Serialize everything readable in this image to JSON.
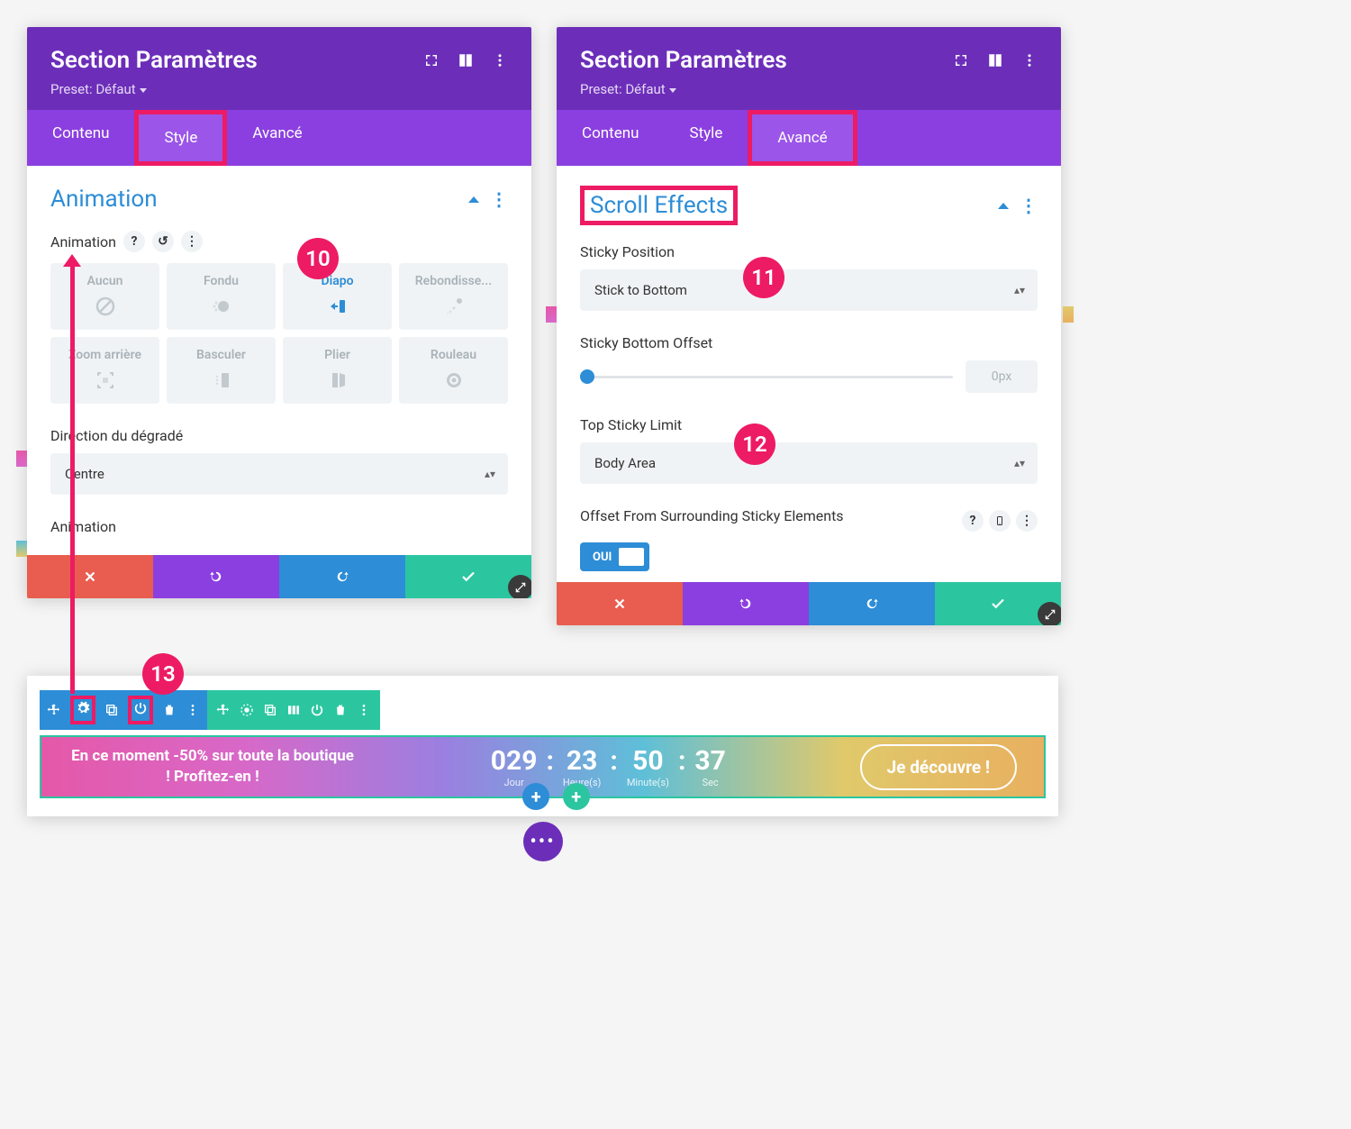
{
  "leftPanel": {
    "title": "Section Paramètres",
    "preset": "Preset: Défaut",
    "tabs": {
      "contenu": "Contenu",
      "style": "Style",
      "avance": "Avancé"
    },
    "sectionTitle": "Animation",
    "animLabel": "Animation",
    "help": "?",
    "options": {
      "aucun": "Aucun",
      "fondu": "Fondu",
      "diapo": "Diapo",
      "rebond": "Rebondisse...",
      "zoom": "Zoom arrière",
      "basculer": "Basculer",
      "plier": "Plier",
      "rouleau": "Rouleau"
    },
    "directionLabel": "Direction du dégradé",
    "directionValue": "Centre",
    "animLower": "Animation"
  },
  "rightPanel": {
    "title": "Section Paramètres",
    "preset": "Preset: Défaut",
    "tabs": {
      "contenu": "Contenu",
      "style": "Style",
      "avance": "Avancé"
    },
    "sectionTitle": "Scroll Effects",
    "stickyPosLabel": "Sticky Position",
    "stickyPosValue": "Stick to Bottom",
    "stickyOffsetLabel": "Sticky Bottom Offset",
    "stickyOffsetValue": "0px",
    "topLimitLabel": "Top Sticky Limit",
    "topLimitValue": "Body Area",
    "offsetElLabel": "Offset From Surrounding Sticky Elements",
    "toggleLabel": "OUI",
    "help": "?"
  },
  "markers": {
    "m10": "10",
    "m11": "11",
    "m12": "12",
    "m13": "13"
  },
  "banner": {
    "text": "En ce moment -50% sur toute la boutique ! Profitez-en !",
    "cd": {
      "d": "029",
      "h": "23",
      "m": "50",
      "s": "37",
      "dl": "Jour",
      "hl": "Heure(s)",
      "ml": "Minute(s)",
      "sl": "Sec"
    },
    "cta": "Je découvre !",
    "colon": ":"
  }
}
